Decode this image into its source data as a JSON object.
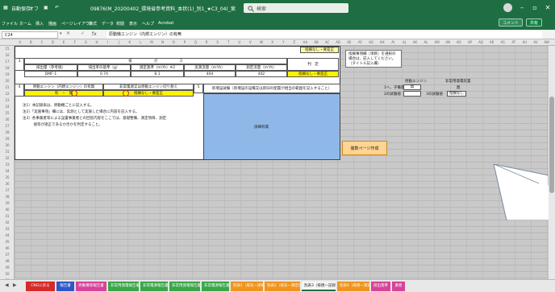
{
  "window": {
    "autosave_label": "自動保存",
    "autosave_state": "オフ",
    "filename": "09876(M_20200402_環境省参考資料_本状(1)_別1_★C3_04(_案(説明)1_完_印刷)_最終修正 — ",
    "search_placeholder": "検索",
    "user_name": "",
    "minimize": "–",
    "maximize": "▫",
    "close": "✕"
  },
  "ribbon": {
    "menu": [
      "ファイル",
      "ホーム",
      "挿入",
      "描画",
      "ページレイアウト",
      "数式",
      "データ",
      "校閲",
      "表示",
      "ヘルプ",
      "Acrobat"
    ],
    "comments_label": "コメント",
    "share_label": "共有"
  },
  "formula_bar": {
    "name_box": "C24",
    "fx": "fx",
    "formula": "原動機エンジン（内燃エンジン）の有無"
  },
  "column_headers": [
    "A",
    "B",
    "C",
    "D",
    "E",
    "F",
    "G",
    "H",
    "I",
    "J",
    "K",
    "L",
    "M",
    "N",
    "O",
    "P",
    "Q",
    "R",
    "S",
    "T",
    "U",
    "V",
    "W",
    "X",
    "Y",
    "Z",
    "AA",
    "AB",
    "AC",
    "AD",
    "AE",
    "AF",
    "AG",
    "AH",
    "AI",
    "AJ",
    "AK",
    "AL",
    "AM",
    "AN",
    "AO",
    "AP",
    "AQ",
    "AR",
    "AS",
    "AT",
    "AU",
    "AV",
    "AW"
  ],
  "row_headers": [
    "15",
    "16",
    "17",
    "18",
    "19",
    "20",
    "21",
    "22",
    "23",
    "24",
    "25",
    "26",
    "27",
    "28",
    "29",
    "30",
    "31",
    "32",
    "33",
    "34",
    "35",
    "36",
    "37",
    "38",
    "39",
    "40",
    "41",
    "42",
    "43",
    "44",
    "45",
    "46",
    "47",
    "48",
    "49",
    "50",
    "51"
  ],
  "form": {
    "top_note": "指摘なし・要是正",
    "section3": {
      "number": "3",
      "header": "排　　　　　　ガ　　　　　　ス",
      "judgment_header": "判　定",
      "col1": "排出量（参考値）",
      "col2": "排出率の基準（g）",
      "col3": "測定基準（m³/h）※2",
      "col4": "実測流量（m³/h）",
      "col5": "測定流量（m³/h）",
      "val1": "DMF-1",
      "val2": "0.74",
      "val3": "8.1",
      "val4": "404",
      "val5": "402",
      "judgment": "指摘なし・要是正"
    },
    "section4": {
      "number": "4",
      "label": "原動エンジン（内燃エンジン）の有無",
      "sub_label": "非常電源又は原動エンジン切り替え",
      "value_left": "有　・　無",
      "value_right": "指摘なし・要是正"
    },
    "section5": {
      "number": "5",
      "label": "新増設試験（新増設の設備又は新旧の配置が相当の範囲を記入すること）"
    },
    "notes": [
      "注1）本記録表は、原動機ごとに記入する。",
      "注2）「実施事項」欄には、実測として実施した場合に内容を記入する。",
      "注3）各事業者等による設置事業者との回答内容をここでは、基礎整備、測定項目、測定",
      "　　　値等が適正であるか否かを判定すること。"
    ],
    "blue_box_label": "詳細有無"
  },
  "tooltip": {
    "lines": [
      "指摘事項欄（項目）を選択の",
      "場合は、記入してください。",
      "（タイトル記入欄）"
    ]
  },
  "orange_button": "複数ページ作成",
  "right_panel": {
    "label_a": "原動エンジン",
    "label_b": "非常用発電装置",
    "label_c": "無",
    "row1_left": "1へ、子備電",
    "row1_box": "無",
    "row2_left": "2の試験値",
    "row2_box": "",
    "row2_mid": "3の試験値",
    "row2_box2": "指摘なし"
  },
  "tabs": [
    {
      "label": "CNGに戻る",
      "color": "#d42a2a"
    },
    {
      "label": "報告書",
      "color": "#2d59c8"
    },
    {
      "label": "原動機等報告書",
      "color": "#d6449a"
    },
    {
      "label": "非常用発電報告書",
      "color": "#3aa64a"
    },
    {
      "label": "非常電源報告書",
      "color": "#3aa64a"
    },
    {
      "label": "非常用発電報告書",
      "color": "#3aa64a"
    },
    {
      "label": "非常電源報告書",
      "color": "#3aa64a"
    },
    {
      "label": "別表1（排気ー詳細表）",
      "color": "#f0941e"
    },
    {
      "label": "別表2（排気ー測定値）",
      "color": "#f0941e"
    },
    {
      "label": "別表3（排煙ー記録表）",
      "color": "#f5f5f5"
    },
    {
      "label": "別表4（排煙ー測定値）",
      "color": "#f0941e"
    },
    {
      "label": "排出基準",
      "color": "#d6449a"
    },
    {
      "label": "業者",
      "color": "#d6449a"
    }
  ],
  "status_bar": {
    "ready": ""
  }
}
